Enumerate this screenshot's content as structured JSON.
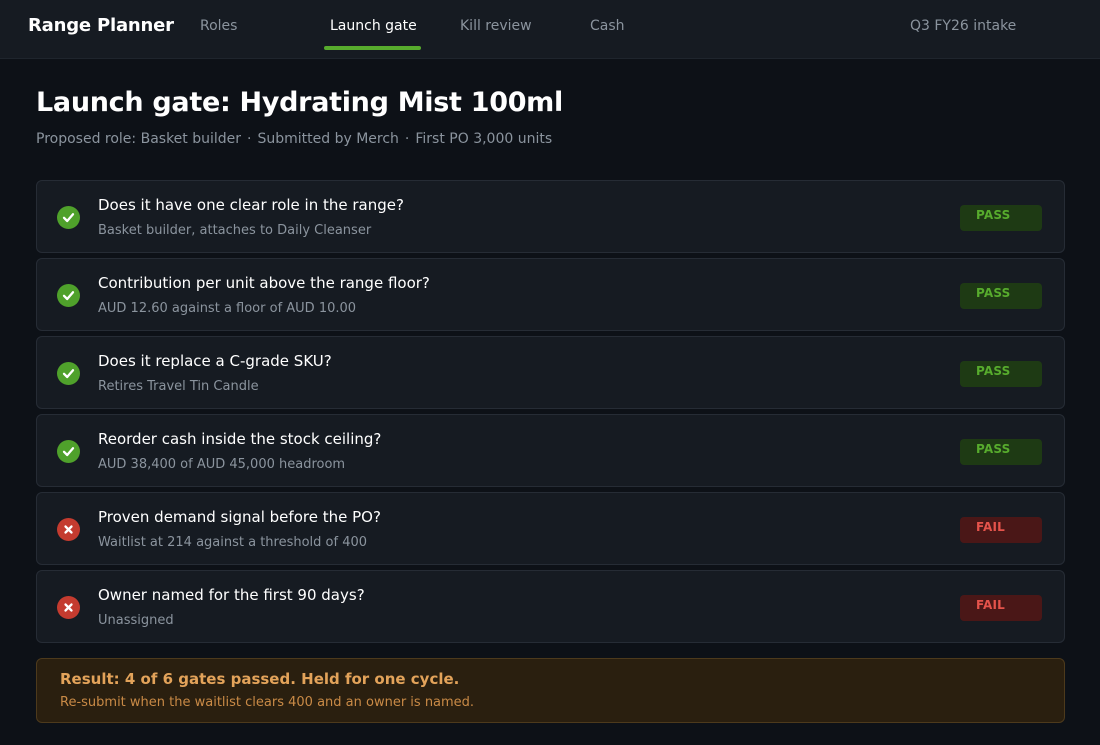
{
  "app": {
    "title": "Range Planner"
  },
  "nav": {
    "items": [
      {
        "label": "Roles",
        "active": false
      },
      {
        "label": "Launch gate",
        "active": true
      },
      {
        "label": "Kill review",
        "active": false
      },
      {
        "label": "Cash",
        "active": false
      }
    ],
    "intake": "Q3 FY26 intake"
  },
  "page": {
    "title": "Launch gate: Hydrating Mist 100ml",
    "subtitle": {
      "role": "Proposed role: Basket builder",
      "submitted": "Submitted by Merch",
      "po": "First PO 3,000 units",
      "separator": "·"
    }
  },
  "gates": [
    {
      "question": "Does it have one clear role in the range?",
      "detail": "Basket builder, attaches to Daily Cleanser",
      "status": "pass",
      "badge": "PASS",
      "icon": "check-icon"
    },
    {
      "question": "Contribution per unit above the range floor?",
      "detail": "AUD 12.60 against a floor of AUD 10.00",
      "status": "pass",
      "badge": "PASS",
      "icon": "check-icon"
    },
    {
      "question": "Does it replace a C-grade SKU?",
      "detail": "Retires Travel Tin Candle",
      "status": "pass",
      "badge": "PASS",
      "icon": "check-icon"
    },
    {
      "question": "Reorder cash inside the stock ceiling?",
      "detail": "AUD 38,400 of AUD 45,000 headroom",
      "status": "pass",
      "badge": "PASS",
      "icon": "check-icon"
    },
    {
      "question": "Proven demand signal before the PO?",
      "detail": "Waitlist at 214 against a threshold of 400",
      "status": "fail",
      "badge": "FAIL",
      "icon": "cross-icon"
    },
    {
      "question": "Owner named for the first 90 days?",
      "detail": "Unassigned",
      "status": "fail",
      "badge": "FAIL",
      "icon": "cross-icon"
    }
  ],
  "result": {
    "headline": "Result: 4 of 6 gates passed. Held for one cycle.",
    "note": "Re-submit when the waitlist clears 400 and an owner is named."
  },
  "colors": {
    "background": "#0d1117",
    "topbar": "#161b22",
    "accent": "#57ab2d",
    "pass": "#4fa12b",
    "fail": "#c43b2f",
    "warning": "#e3a35a"
  }
}
